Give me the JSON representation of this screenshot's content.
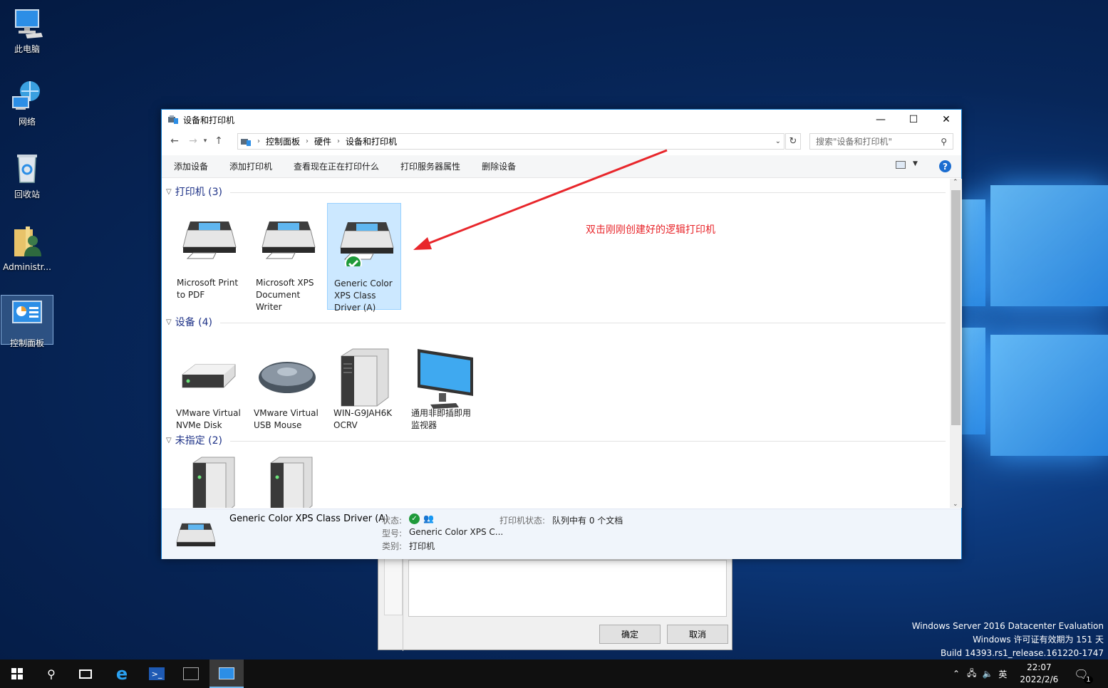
{
  "desktop": {
    "icons": [
      {
        "label": "此电脑"
      },
      {
        "label": "网络"
      },
      {
        "label": "回收站"
      },
      {
        "label": "Administr..."
      },
      {
        "label": "控制面板"
      }
    ],
    "watermark": {
      "line1": "Windows Server 2016 Datacenter Evaluation",
      "line2": "Windows 许可证有效期为 151 天",
      "line3": "Build 14393.rs1_release.161220-1747"
    }
  },
  "back_dialog": {
    "ok_label": "确定",
    "cancel_label": "取消"
  },
  "window": {
    "title": "设备和打印机",
    "controls": {
      "minimize": "—",
      "maximize": "☐",
      "close": "✕"
    },
    "breadcrumb": [
      "控制面板",
      "硬件",
      "设备和打印机"
    ],
    "search_placeholder": "搜索\"设备和打印机\"",
    "toolbar": [
      "添加设备",
      "添加打印机",
      "查看现在正在打印什么",
      "打印服务器属性",
      "删除设备"
    ],
    "help": "?",
    "groups": {
      "printers": {
        "header": "打印机 (3)",
        "items": [
          {
            "label": "Microsoft Print to PDF",
            "icon": "printer-icon"
          },
          {
            "label": "Microsoft XPS Document Writer",
            "icon": "printer-icon"
          },
          {
            "label": "Generic Color XPS Class Driver (A)",
            "icon": "printer-default-icon",
            "selected": true
          }
        ]
      },
      "devices": {
        "header": "设备 (4)",
        "items": [
          {
            "label": "VMware Virtual NVMe Disk",
            "icon": "disk-icon"
          },
          {
            "label": "VMware Virtual USB Mouse",
            "icon": "mouse-icon"
          },
          {
            "label": "WIN-G9JAH6K OCRV",
            "icon": "tower-icon"
          },
          {
            "label": "通用非即插即用监视器",
            "icon": "monitor-icon"
          }
        ]
      },
      "unspecified": {
        "header": "未指定 (2)",
        "items": [
          {
            "label": "",
            "icon": "tower-icon"
          },
          {
            "label": "",
            "icon": "tower-icon"
          }
        ]
      }
    },
    "details": {
      "name": "Generic Color XPS Class Driver (A)",
      "status_label": "状态:",
      "model_label": "型号:",
      "model_value": "Generic Color XPS C...",
      "category_label": "类别:",
      "category_value": "打印机",
      "printer_status_label": "打印机状态:",
      "printer_status_value": "队列中有 0 个文档"
    }
  },
  "annotation": {
    "text": "双击刚刚创建好的逻辑打印机",
    "color": "#e8262b"
  },
  "taskbar": {
    "time": "22:07",
    "date": "2022/2/6",
    "ime": "英",
    "notification_count": "1"
  }
}
